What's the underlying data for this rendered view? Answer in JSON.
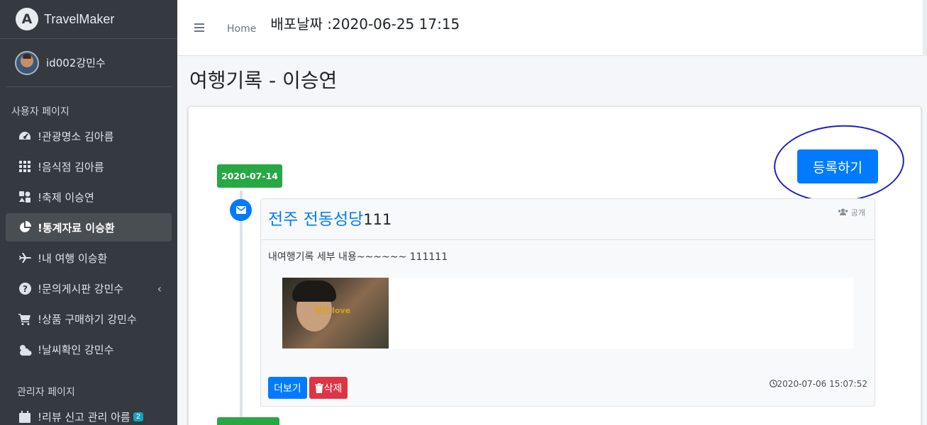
{
  "brand": {
    "name": "TravelMaker",
    "logo_letter": "A"
  },
  "user": {
    "name": "id002강민수"
  },
  "sidebar": {
    "user_header": "사용자 페이지",
    "admin_header": "관리자 페이지",
    "items": [
      {
        "label": "!관광명소 김아름",
        "icon": "tachometer-icon"
      },
      {
        "label": "!음식점 김아름",
        "icon": "grid-icon"
      },
      {
        "label": "!축제 이승연",
        "icon": "festival-icon"
      },
      {
        "label": "!통계자료 이승환",
        "icon": "pie-chart-icon",
        "active": true
      },
      {
        "label": "!내 여행 이승환",
        "icon": "plane-icon"
      },
      {
        "label": "!문의게시판 강민수",
        "icon": "question-icon"
      },
      {
        "label": "!상품 구매하기 강민수",
        "icon": "cart-icon"
      },
      {
        "label": "!날씨확인 강민수",
        "icon": "weather-icon"
      }
    ],
    "admin_items": [
      {
        "label": "!리뷰 신고 관리 아름",
        "badge": "2"
      }
    ]
  },
  "topbar": {
    "home": "Home",
    "deploy": "배포날짜 :2020-06-25 17:15"
  },
  "page": {
    "title": "여행기록 - 이승연",
    "register_button": "등록하기"
  },
  "timeline": {
    "date": "2020-07-14",
    "item": {
      "title_link": "전주 전동성당",
      "title_rest": "111",
      "visibility": "공개",
      "body": "내여행기록 세부 내용~~~~~~ 111111",
      "photo_caption": "완전 love",
      "more_button": "더보기",
      "delete_button": "삭제",
      "timestamp": "2020-07-06 15:07:52"
    }
  },
  "colors": {
    "sidebar": "#343a40",
    "primary": "#007bff",
    "success": "#28a745",
    "danger": "#dc3545",
    "annotation": "#1f1fc8"
  }
}
